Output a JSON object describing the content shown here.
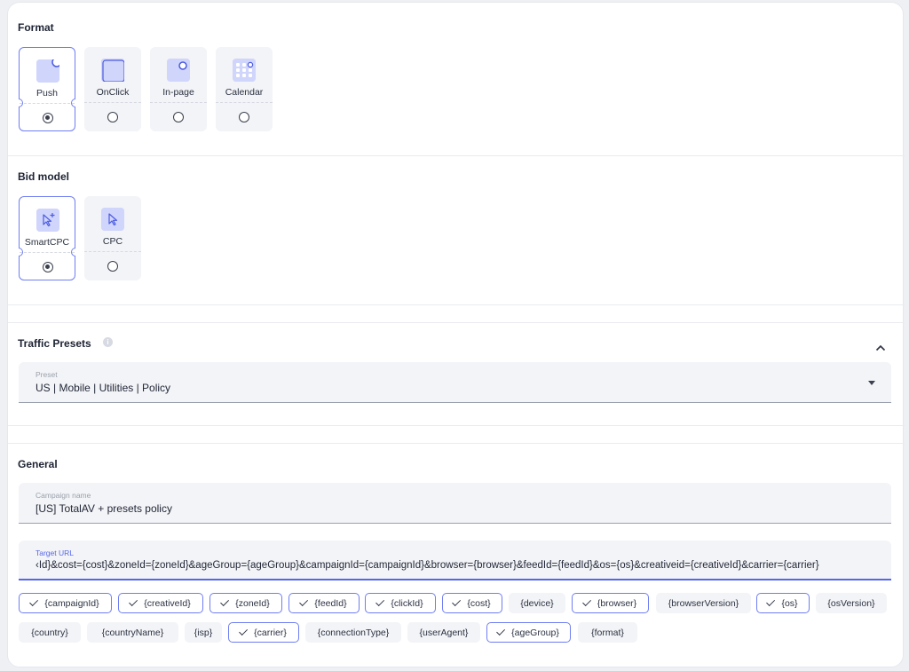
{
  "format": {
    "title": "Format",
    "options": [
      {
        "label": "Push",
        "selected": true,
        "icon": "push-icon"
      },
      {
        "label": "OnClick",
        "selected": false,
        "icon": "onclick-icon"
      },
      {
        "label": "In-page",
        "selected": false,
        "icon": "inpage-icon"
      },
      {
        "label": "Calendar",
        "selected": false,
        "icon": "calendar-icon"
      }
    ]
  },
  "bid_model": {
    "title": "Bid model",
    "options": [
      {
        "label": "SmartCPC",
        "selected": true,
        "icon": "smart-cursor-icon"
      },
      {
        "label": "CPC",
        "selected": false,
        "icon": "cursor-icon"
      }
    ]
  },
  "traffic_presets": {
    "title": "Traffic Presets",
    "preset_label": "Preset",
    "preset_value": "US | Mobile | Utilities | Policy"
  },
  "general": {
    "title": "General",
    "campaign_name_label": "Campaign name",
    "campaign_name_value": "[US] TotalAV + presets policy",
    "target_url_label": "Target URL",
    "target_url_value": "‹Id}&cost={cost}&zoneId={zoneId}&ageGroup={ageGroup}&campaignId={campaignId}&browser={browser}&feedId={feedId}&os={os}&creativeid={creativeId}&carrier={carrier}"
  },
  "macros": [
    {
      "label": "{campaignId}",
      "on": true
    },
    {
      "label": "{creativeId}",
      "on": true
    },
    {
      "label": "{zoneId}",
      "on": true
    },
    {
      "label": "{feedId}",
      "on": true
    },
    {
      "label": "{clickId}",
      "on": true
    },
    {
      "label": "{cost}",
      "on": true
    },
    {
      "label": "{device}",
      "on": false
    },
    {
      "label": "{browser}",
      "on": true
    },
    {
      "label": "{browserVersion}",
      "on": false
    },
    {
      "label": "{os}",
      "on": true
    },
    {
      "label": "{osVersion}",
      "on": false
    },
    {
      "label": "{country}",
      "on": false
    },
    {
      "label": "{countryName}",
      "on": false
    },
    {
      "label": "{isp}",
      "on": false
    },
    {
      "label": "{carrier}",
      "on": true
    },
    {
      "label": "{connectionType}",
      "on": false
    },
    {
      "label": "{userAgent}",
      "on": false
    },
    {
      "label": "{ageGroup}",
      "on": true
    },
    {
      "label": "{format}",
      "on": false
    }
  ],
  "colors": {
    "accent": "#6f7ef2",
    "tile_bg": "#f3f4f7",
    "icon_bg": "#d0d5fb"
  }
}
